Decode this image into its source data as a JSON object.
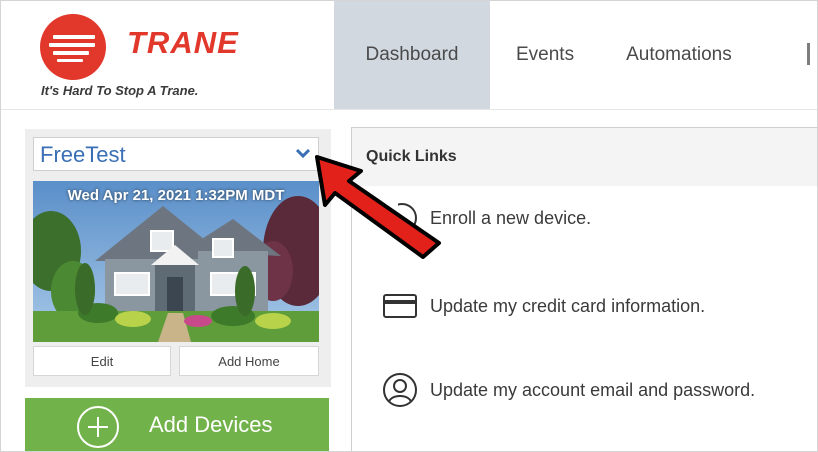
{
  "brand": {
    "wordmark": "TRANE",
    "tagline": "It's Hard To Stop A Trane.",
    "color": "#e2382b"
  },
  "nav": {
    "tabs": [
      {
        "label": "Dashboard",
        "active": true
      },
      {
        "label": "Events",
        "active": false
      },
      {
        "label": "Automations",
        "active": false
      }
    ]
  },
  "home": {
    "selected": "FreeTest",
    "datetime": "Wed Apr 21, 2021 1:32PM MDT",
    "edit_label": "Edit",
    "add_home_label": "Add Home"
  },
  "add_devices": {
    "label": "Add Devices",
    "color": "#72b24a"
  },
  "quick_links": {
    "title": "Quick Links",
    "items": [
      {
        "label": "Enroll a new device.",
        "icon": "device-icon"
      },
      {
        "label": "Update my credit card information.",
        "icon": "credit-card-icon"
      },
      {
        "label": "Update my account email and password.",
        "icon": "user-account-icon"
      }
    ]
  },
  "annotation": {
    "arrow_color": "#e3211b"
  }
}
